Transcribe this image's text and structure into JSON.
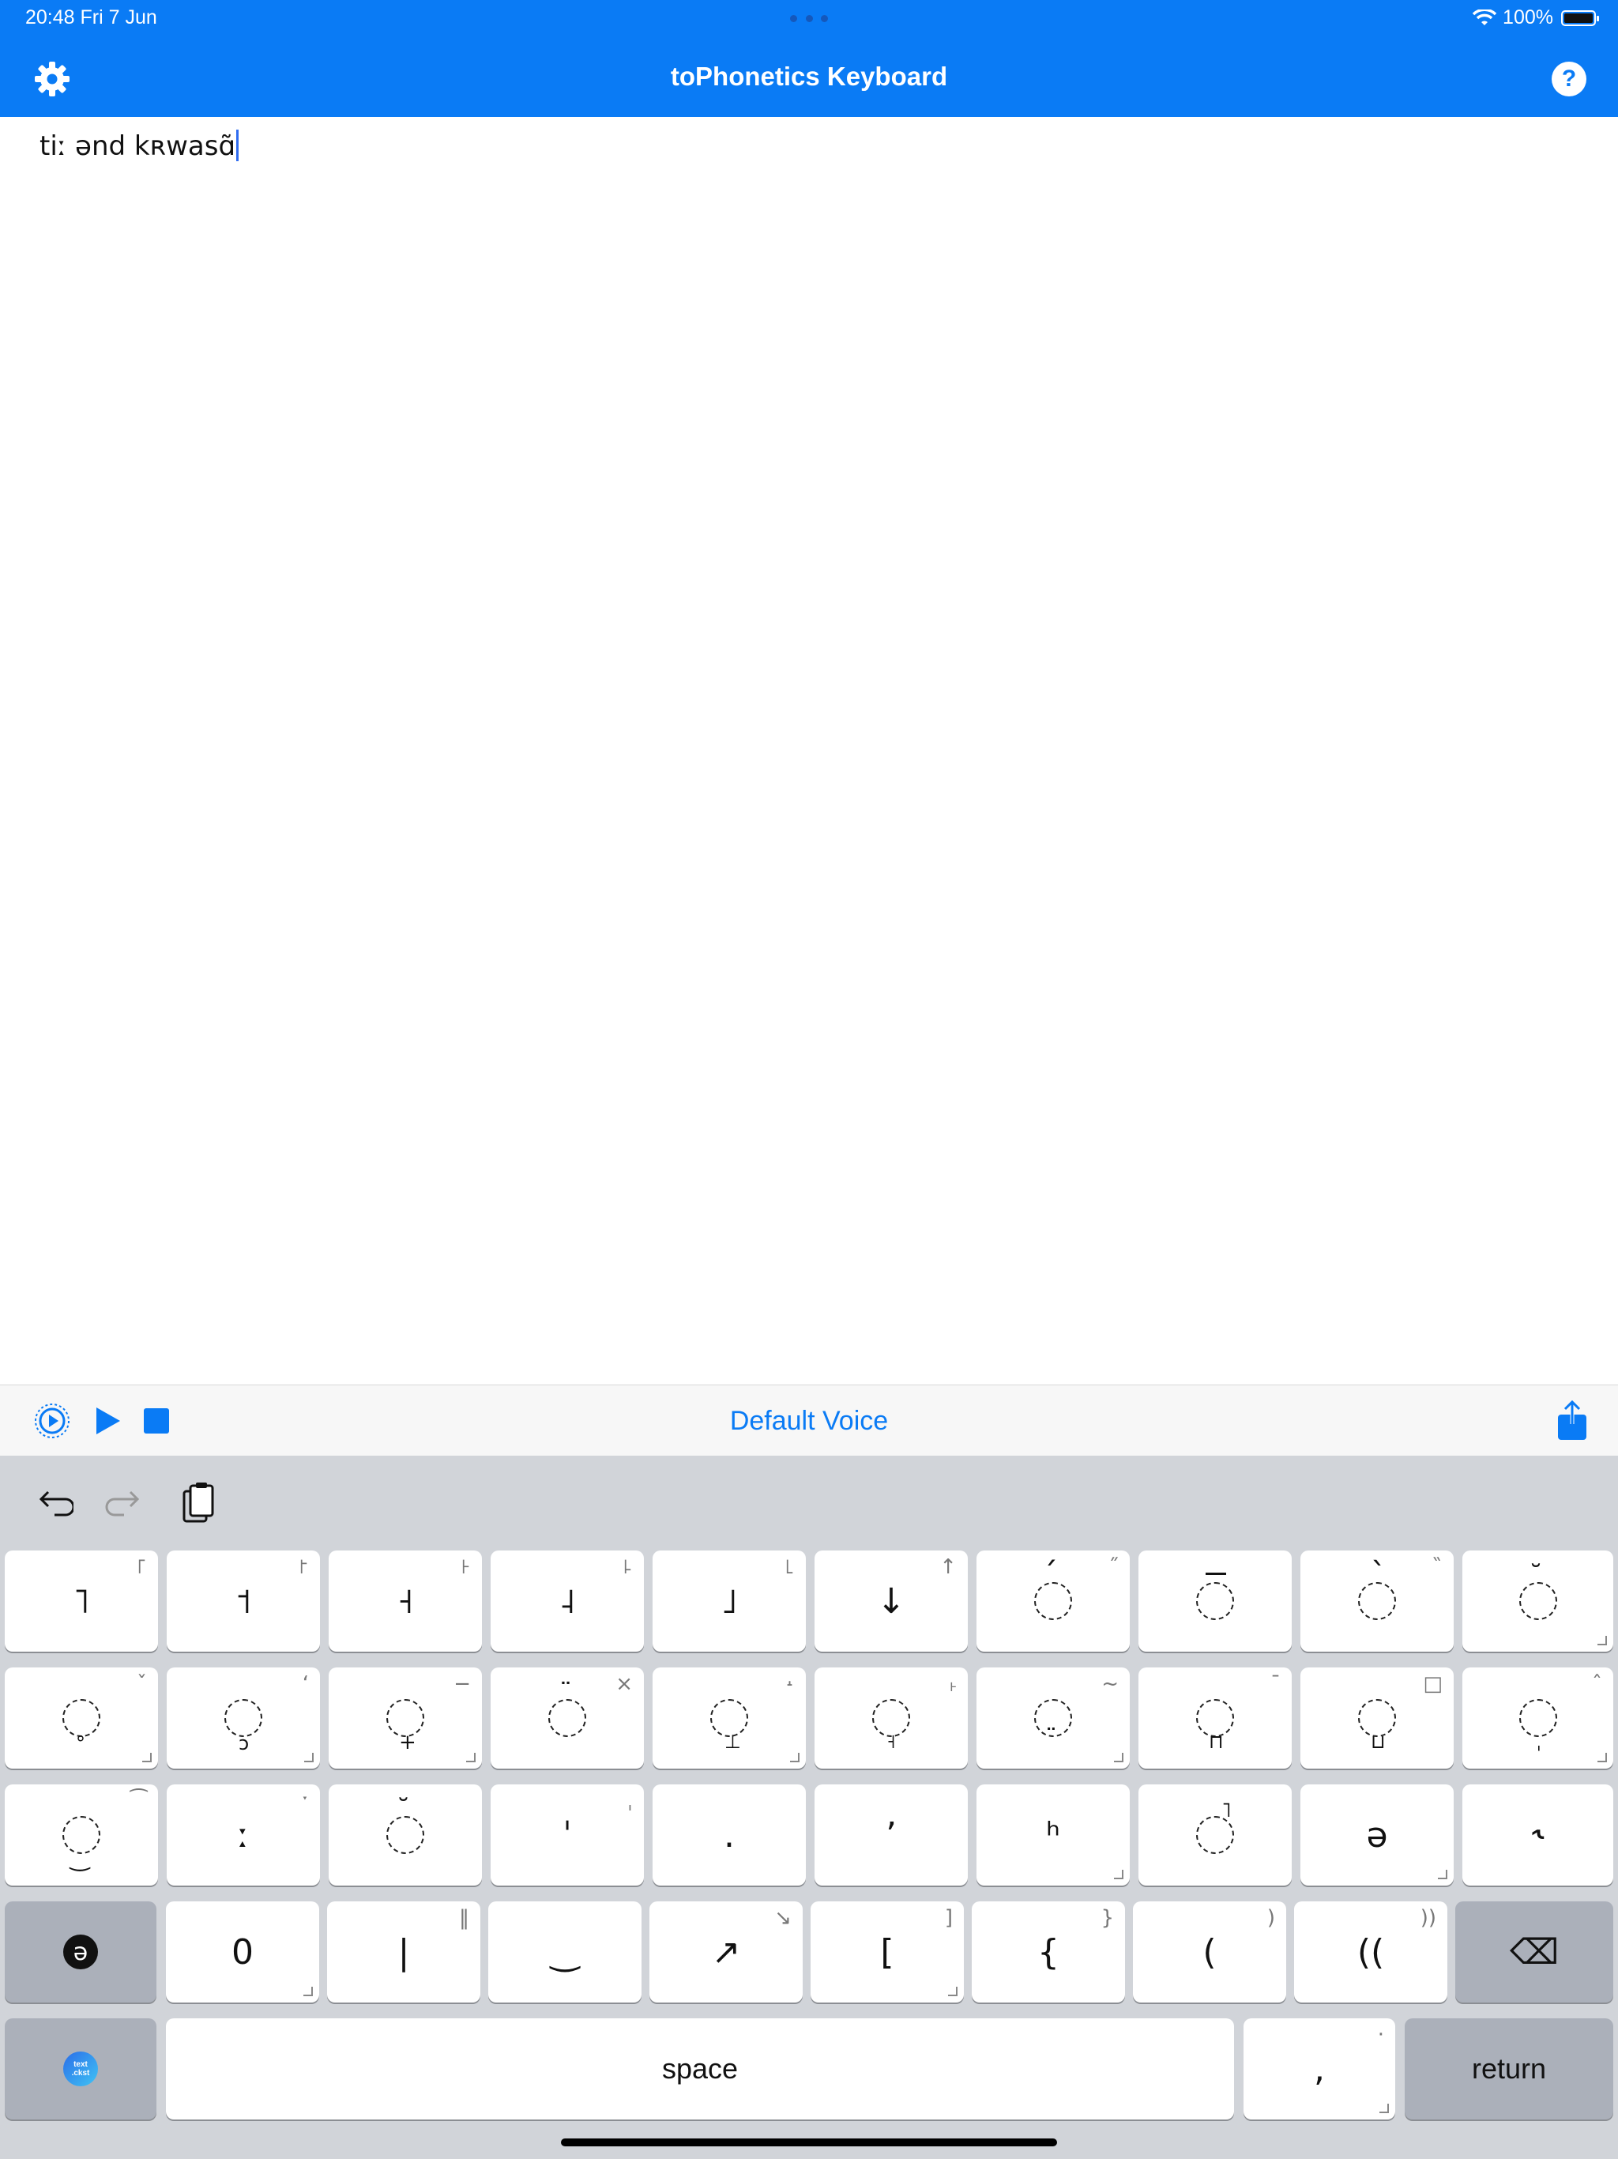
{
  "status": {
    "time": "20:48  Fri 7 Jun",
    "battery": "100%"
  },
  "nav": {
    "title": "toPhonetics Keyboard",
    "help_label": "?"
  },
  "editor": {
    "text": "tiː ənd kʀwasɑ̃"
  },
  "speech": {
    "voice": "Default Voice"
  },
  "colors": {
    "accent": "#0a7bf5",
    "keyboard_bg": "#d1d4d9"
  },
  "keyboard": {
    "row1": [
      {
        "main": "˥",
        "alt": "꜒"
      },
      {
        "main": "˦",
        "alt": "꜓"
      },
      {
        "main": "˧",
        "alt": "꜔"
      },
      {
        "main": "˨",
        "alt": "꜕"
      },
      {
        "main": "˩",
        "alt": "꜖"
      },
      {
        "main": "↓",
        "alt": "↑"
      },
      {
        "main": "◌́",
        "alt": "̋"
      },
      {
        "main": "◌̄",
        "alt": ""
      },
      {
        "main": "◌̀",
        "alt": "̏"
      },
      {
        "main": "◌̆",
        "alt": ""
      }
    ],
    "row2": [
      {
        "main": "◌̥",
        "alt": "ˇ"
      },
      {
        "main": "◌̜",
        "alt": "‘"
      },
      {
        "main": "◌̟",
        "alt": "−"
      },
      {
        "main": "◌̈",
        "alt": "×"
      },
      {
        "main": "◌̞",
        "alt": "˔"
      },
      {
        "main": "◌̘",
        "alt": "˫"
      },
      {
        "main": "◌̤",
        "alt": "~"
      },
      {
        "main": "◌̪",
        "alt": "ˉ"
      },
      {
        "main": "◌̺",
        "alt": "□"
      },
      {
        "main": "◌̩",
        "alt": "ˆ"
      }
    ],
    "row3": [
      {
        "main": "◌͜",
        "alt": "⁀"
      },
      {
        "main": "ː",
        "alt": "ˑ"
      },
      {
        "main": "◌̆",
        "alt": ""
      },
      {
        "main": "ˈ",
        "alt": "ˌ"
      },
      {
        "main": ".",
        "alt": ""
      },
      {
        "main": "ʼ",
        "alt": ""
      },
      {
        "main": "ʰ",
        "alt": ""
      },
      {
        "main": "◌̚",
        "alt": ""
      },
      {
        "main": "ə",
        "alt": ""
      },
      {
        "main": "˞",
        "alt": ""
      }
    ],
    "row4": [
      {
        "main": "ə",
        "alt": ""
      },
      {
        "main": "0",
        "alt": ""
      },
      {
        "main": "|",
        "alt": "‖"
      },
      {
        "main": "‿",
        "alt": ""
      },
      {
        "main": "↗",
        "alt": "↘"
      },
      {
        "main": "[",
        "alt": "]"
      },
      {
        "main": "{",
        "alt": "}"
      },
      {
        "main": "(",
        "alt": ")"
      },
      {
        "main": "((",
        "alt": "))"
      },
      {
        "main": "⌫",
        "alt": ""
      }
    ],
    "row5": {
      "globe": "text\n.ckst",
      "space": "space",
      "comma": ",",
      "comma_alt": "·",
      "return": "return"
    }
  }
}
